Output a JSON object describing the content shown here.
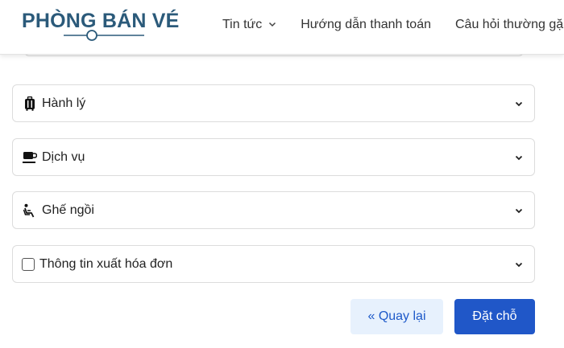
{
  "header": {
    "logo_text": "PHÒNG BÁN VÉ",
    "nav": [
      {
        "label": "Tin tức",
        "has_dropdown": true
      },
      {
        "label": "Hướng dẫn thanh toán"
      },
      {
        "label": "Câu hỏi thường gặp"
      }
    ]
  },
  "sections": [
    {
      "label": "Hành lý",
      "icon": "luggage-icon"
    },
    {
      "label": "Dịch vụ",
      "icon": "coffee-cup-icon"
    },
    {
      "label": "Ghế ngồi",
      "icon": "seat-icon"
    },
    {
      "label": "Thông tin xuất hóa đơn",
      "icon": "checkbox",
      "checked": false
    }
  ],
  "actions": {
    "back_label": "« Quay lại",
    "book_label": "Đặt chỗ"
  },
  "colors": {
    "logo": "#2b5a7a",
    "primary": "#2057c8",
    "secondary_bg": "#e7f1fd",
    "secondary_text": "#1d59c9",
    "border": "#dcdcdc"
  }
}
